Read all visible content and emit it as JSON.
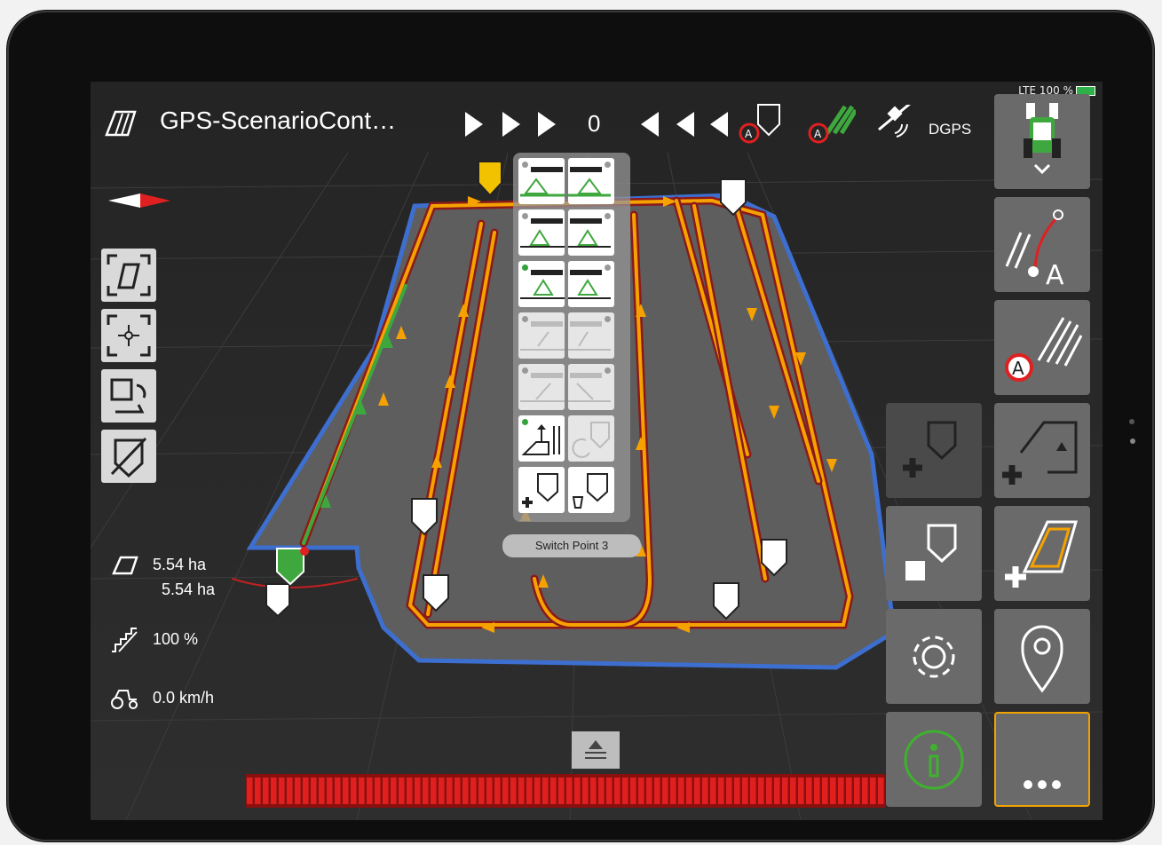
{
  "status_bar": {
    "signal": "LTE 100 %"
  },
  "header": {
    "title": "GPS-ScenarioCont…",
    "counter": "0",
    "gps_mode": "DGPS"
  },
  "switch_point_label": "Switch Point 3",
  "stats": {
    "area_total": "5.54 ha",
    "area_worked": "5.54 ha",
    "rate": "100 %",
    "speed": "0.0 km/h"
  },
  "left_toolbar": [
    "field-view-icon",
    "center-focus-icon",
    "map-rotate-icon",
    "marker-hide-icon"
  ],
  "right_toolbar": [
    "tractor-select-icon",
    "guidance-ab-icon",
    "auto-track-icon",
    "add-marker-icon",
    "add-boundary-icon",
    "stop-marker-icon",
    "add-field-icon",
    "settings-gear-icon",
    "location-pin-icon",
    "info-icon",
    "more-icon"
  ],
  "colors": {
    "boundary": "#3d6fd0",
    "track_active": "#f5a200",
    "track_green": "#3ea83e",
    "info_green": "#3fb12f",
    "more_border": "#f0a200",
    "progress_red": "#e01f1f"
  },
  "progress": {
    "segments_filled": 1.0
  }
}
